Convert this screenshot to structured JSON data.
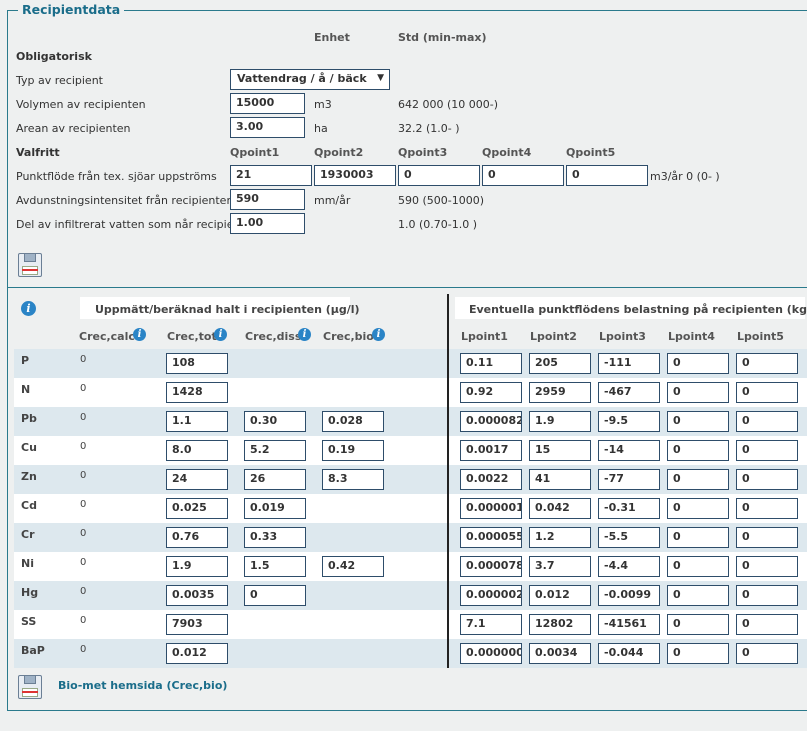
{
  "section_title": "Recipientdata",
  "col_headers": {
    "unit": "Enhet",
    "std": "Std (min-max)"
  },
  "mandatory_title": "Obligatorisk",
  "recipient_type": {
    "label": "Typ av recipient",
    "value": "Vattendrag / å / bäck"
  },
  "volume": {
    "label": "Volymen av recipienten",
    "value": "15000",
    "unit": "m3",
    "std": "642 000 (10 000-)"
  },
  "area": {
    "label": "Arean av recipienten",
    "value": "3.00",
    "unit": "ha",
    "std": "32.2 (1.0- )"
  },
  "optional_title": "Valfritt",
  "qpoint_headers": [
    "Qpoint1",
    "Qpoint2",
    "Qpoint3",
    "Qpoint4",
    "Qpoint5"
  ],
  "point_flow": {
    "label": "Punktflöde från tex. sjöar uppströms",
    "values": [
      "21",
      "1930003",
      "0",
      "0",
      "0"
    ],
    "unit_std": "m3/år 0 (0- )"
  },
  "evaporation": {
    "label": "Avdunstningsintensitet från recipienten",
    "value": "590",
    "unit": "mm/år",
    "std": "590 (500-1000)"
  },
  "infiltration": {
    "label": "Del av infiltrerat vatten som når recipienten",
    "value": "1.00",
    "std": "1.0 (0.70-1.0 )"
  },
  "left_table_title": "Uppmätt/beräknad halt i recipienten (µg/l)",
  "right_table_title": "Eventuella punktflödens belastning på recipienten (kg/år)",
  "crec_headers": [
    "Crec,calc",
    "Crec,tot",
    "Crec,diss",
    "Crec,bio"
  ],
  "lpoint_headers": [
    "Lpoint1",
    "Lpoint2",
    "Lpoint3",
    "Lpoint4",
    "Lpoint5"
  ],
  "rows": [
    {
      "name": "P",
      "calc": "0",
      "tot": "108",
      "diss": null,
      "bio": null,
      "l": [
        "0.11",
        "205",
        "-111",
        "0",
        "0"
      ]
    },
    {
      "name": "N",
      "calc": "0",
      "tot": "1428",
      "diss": null,
      "bio": null,
      "l": [
        "0.92",
        "2959",
        "-467",
        "0",
        "0"
      ]
    },
    {
      "name": "Pb",
      "calc": "0",
      "tot": "1.1",
      "diss": "0.30",
      "bio": "0.028",
      "l": [
        "0.000082",
        "1.9",
        "-9.5",
        "0",
        "0"
      ]
    },
    {
      "name": "Cu",
      "calc": "0",
      "tot": "8.0",
      "diss": "5.2",
      "bio": "0.19",
      "l": [
        "0.0017",
        "15",
        "-14",
        "0",
        "0"
      ]
    },
    {
      "name": "Zn",
      "calc": "0",
      "tot": "24",
      "diss": "26",
      "bio": "8.3",
      "l": [
        "0.0022",
        "41",
        "-77",
        "0",
        "0"
      ]
    },
    {
      "name": "Cd",
      "calc": "0",
      "tot": "0.025",
      "diss": "0.019",
      "bio": null,
      "l": [
        "0.000001",
        "0.042",
        "-0.31",
        "0",
        "0"
      ]
    },
    {
      "name": "Cr",
      "calc": "0",
      "tot": "0.76",
      "diss": "0.33",
      "bio": null,
      "l": [
        "0.000055",
        "1.2",
        "-5.5",
        "0",
        "0"
      ]
    },
    {
      "name": "Ni",
      "calc": "0",
      "tot": "1.9",
      "diss": "1.5",
      "bio": "0.42",
      "l": [
        "0.000078",
        "3.7",
        "-4.4",
        "0",
        "0"
      ]
    },
    {
      "name": "Hg",
      "calc": "0",
      "tot": "0.0035",
      "diss": "0",
      "bio": null,
      "l": [
        "0.000002",
        "0.012",
        "-0.0099",
        "0",
        "0"
      ]
    },
    {
      "name": "SS",
      "calc": "0",
      "tot": "7903",
      "diss": null,
      "bio": null,
      "l": [
        "7.1",
        "12802",
        "-41561",
        "0",
        "0"
      ]
    },
    {
      "name": "BaP",
      "calc": "0",
      "tot": "0.012",
      "diss": null,
      "bio": null,
      "l": [
        "0.000000",
        "0.0034",
        "-0.044",
        "0",
        "0"
      ]
    }
  ],
  "biomet_link": "Bio-met hemsida (Crec,bio)",
  "icons": {
    "save": "floppy-disk-icon",
    "info": "info-icon"
  }
}
